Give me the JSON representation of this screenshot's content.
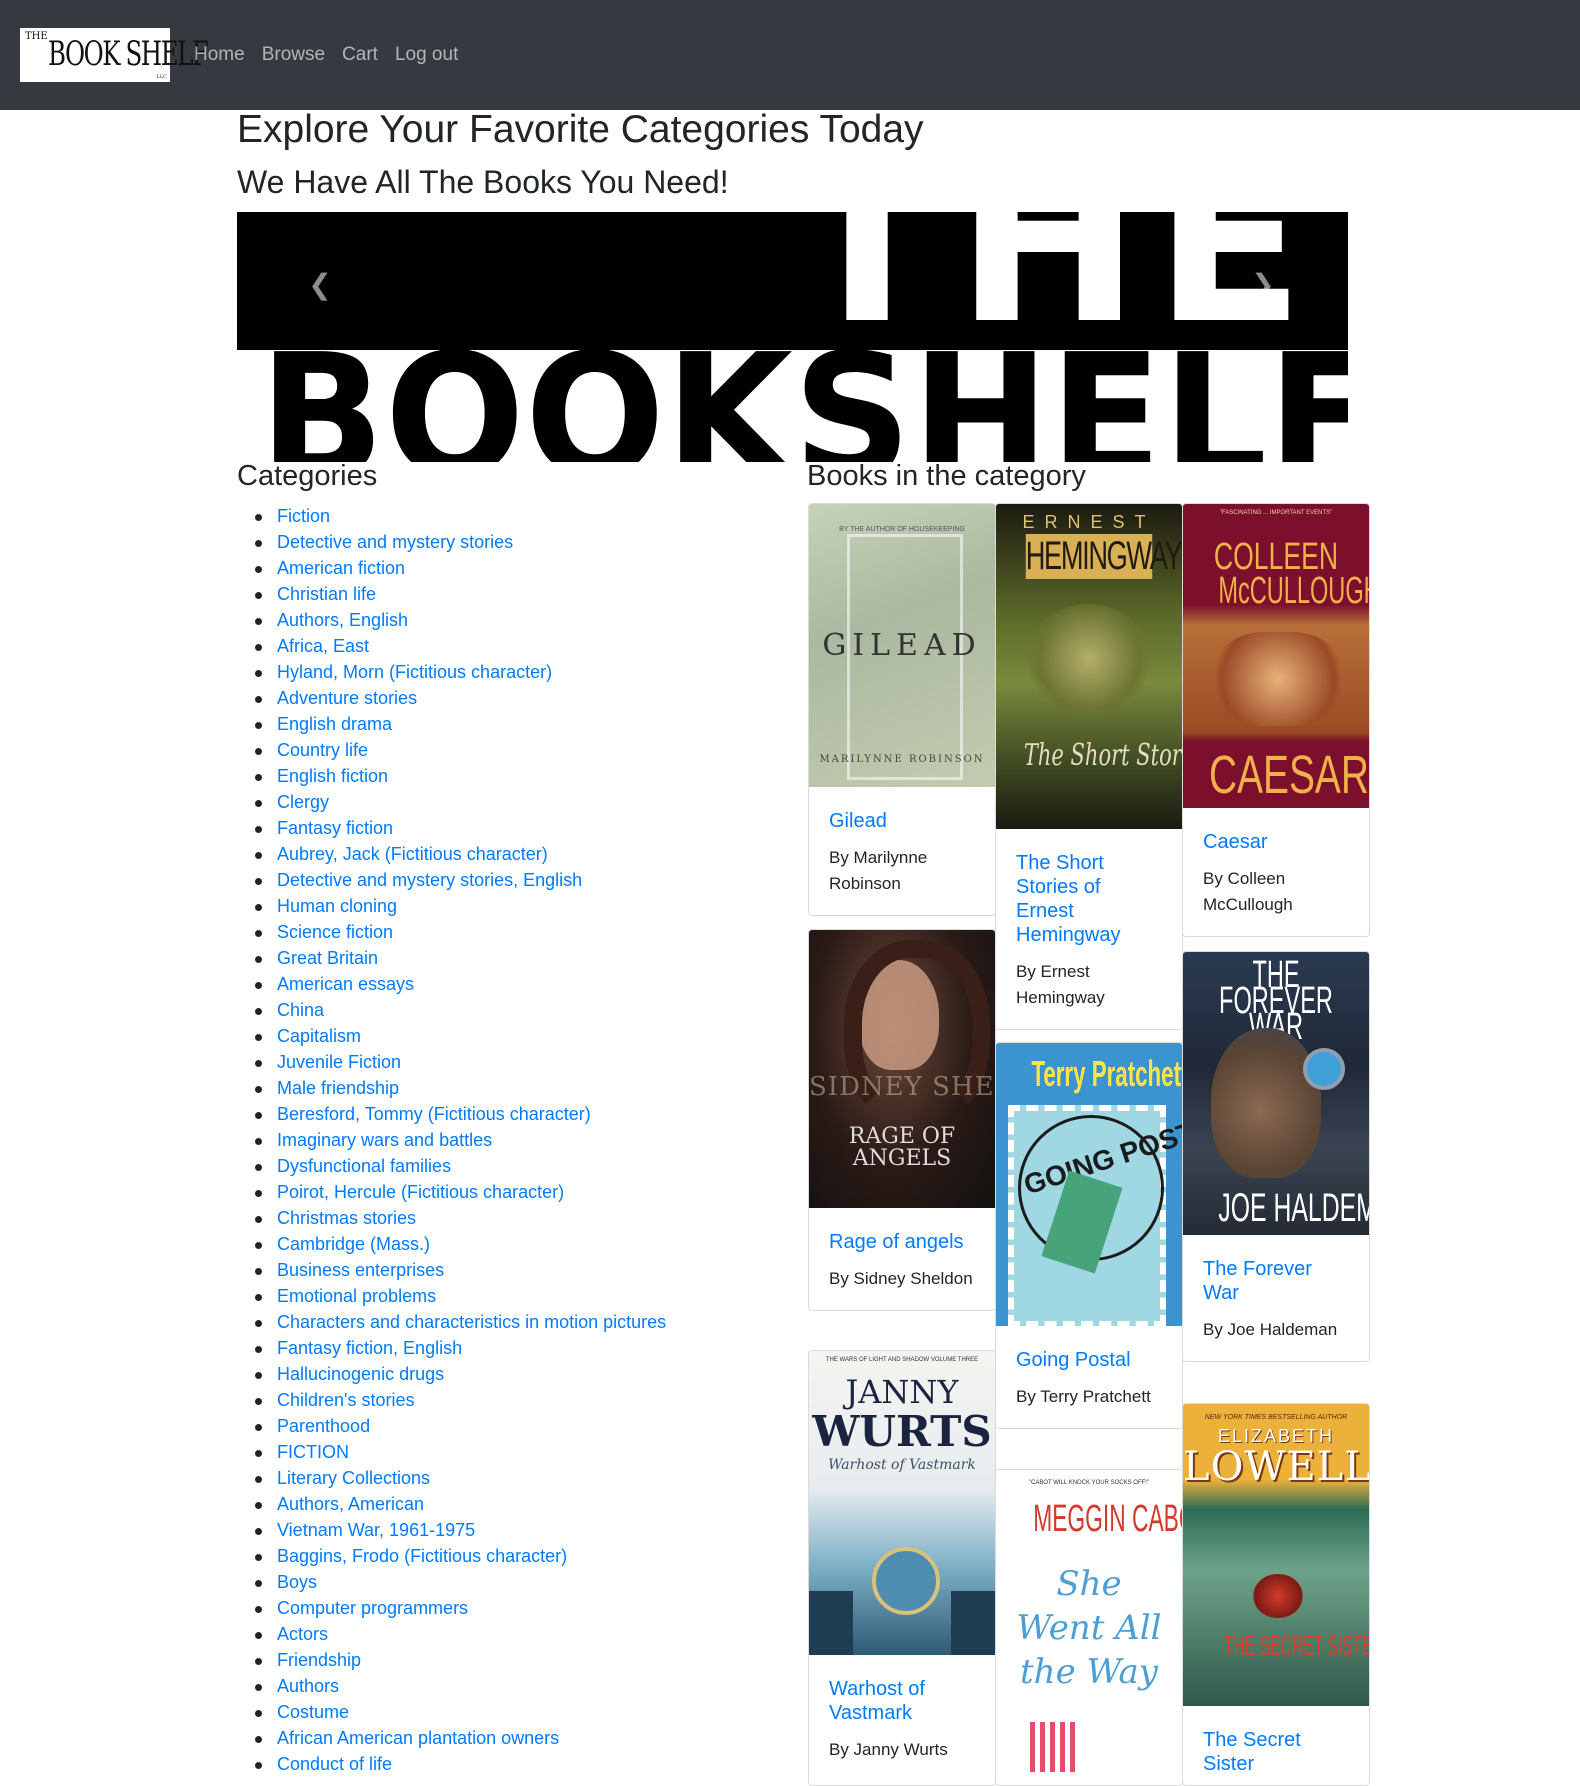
{
  "navbar": {
    "brand": {
      "the": "THE",
      "text": "BOOK SHELF",
      "llc": "LLC"
    },
    "links": [
      "Home",
      "Browse",
      "Cart",
      "Log out"
    ]
  },
  "headings": {
    "main": "Explore Your Favorite Categories Today",
    "sub": "We Have All The Books You Need!"
  },
  "carousel": {
    "logo_the": "THE",
    "logo_bookshelf": "BOOKSHELF",
    "prev_icon": "chevron-left-icon",
    "next_icon": "chevron-right-icon"
  },
  "categories": {
    "heading": "Categories",
    "items": [
      "Fiction",
      "Detective and mystery stories",
      "American fiction",
      "Christian life",
      "Authors, English",
      "Africa, East",
      "Hyland, Morn (Fictitious character)",
      "Adventure stories",
      "English drama",
      "Country life",
      "English fiction",
      "Clergy",
      "Fantasy fiction",
      "Aubrey, Jack (Fictitious character)",
      "Detective and mystery stories, English",
      "Human cloning",
      "Science fiction",
      "Great Britain",
      "American essays",
      "China",
      "Capitalism",
      "Juvenile Fiction",
      "Male friendship",
      "Beresford, Tommy (Fictitious character)",
      "Imaginary wars and battles",
      "Dysfunctional families",
      "Poirot, Hercule (Fictitious character)",
      "Christmas stories",
      "Cambridge (Mass.)",
      "Business enterprises",
      "Emotional problems",
      "Characters and characteristics in motion pictures",
      "Fantasy fiction, English",
      "Hallucinogenic drugs",
      "Children's stories",
      "Parenthood",
      "FICTION",
      "Literary Collections",
      "Authors, American",
      "Vietnam War, 1961-1975",
      "Baggins, Frodo (Fictitious character)",
      "Boys",
      "Computer programmers",
      "Actors",
      "Friendship",
      "Authors",
      "Costume",
      "African American plantation owners",
      "Conduct of life"
    ]
  },
  "books": {
    "heading": "Books in the category",
    "items": [
      {
        "title": "Gilead",
        "author": "By Marilynne Robinson",
        "cover": {
          "top": "BY THE AUTHOR OF HOUSEKEEPING",
          "main": "GILEAD",
          "bottom": "MARILYNNE ROBINSON"
        }
      },
      {
        "title": "The Short Stories of Ernest Hemingway",
        "author": "By Ernest Hemingway",
        "cover": {
          "top": "ERNEST",
          "main": "HEMINGWAY",
          "bottom": "The Short Stories"
        }
      },
      {
        "title": "Caesar",
        "author": "By Colleen McCullough",
        "cover": {
          "top": "COLLEEN",
          "main": "McCULLOUGH",
          "bottom": "CAESAR"
        }
      },
      {
        "title": "Rage of angels",
        "author": "By Sidney Sheldon",
        "cover": {
          "top": "SIDNEY SHELDON",
          "main": "RAGE OF ANGELS",
          "bottom": ""
        }
      },
      {
        "title": "Going Postal",
        "author": "By Terry Pratchett",
        "cover": {
          "top": "Terry Pratchett",
          "main": "GOING POSTAL",
          "bottom": ""
        }
      },
      {
        "title": "The Forever War",
        "author": "By Joe Haldeman",
        "cover": {
          "top": "THE FOREVER WAR",
          "main": "",
          "bottom": "JOE HALDEMAN"
        }
      },
      {
        "title": "Warhost of Vastmark",
        "author": "By Janny Wurts",
        "cover": {
          "top": "JANNY",
          "main": "WURTS",
          "bottom": "Warhost of Vastmark"
        }
      },
      {
        "title": "She Went All the Way",
        "author": "By Meggin Cabot",
        "cover": {
          "top": "MEGGIN CABOT",
          "main": "She Went All the Way",
          "bottom": ""
        }
      },
      {
        "title": "The Secret Sister",
        "author": "By Elizabeth Lowell",
        "cover": {
          "top": "ELIZABETH",
          "main": "LOWELL",
          "bottom": "THE SECRET SISTER"
        }
      }
    ]
  }
}
